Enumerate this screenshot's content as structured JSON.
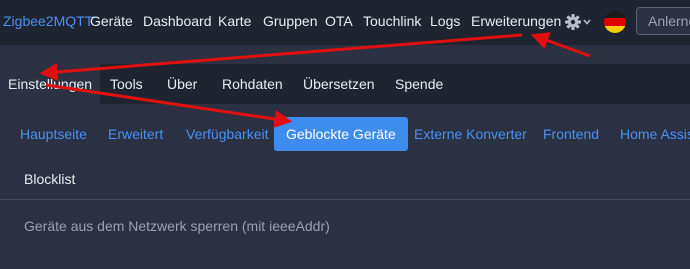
{
  "navbar": {
    "brand": "Zigbee2MQTT",
    "links": [
      "Geräte",
      "Dashboard",
      "Karte",
      "Gruppen",
      "OTA",
      "Touchlink",
      "Logs",
      "Erweiterungen"
    ],
    "settings_icon": "gear-icon",
    "flag_icon": "german-flag-icon",
    "search_placeholder": "Anlernen"
  },
  "tabs": [
    "Einstellungen",
    "Tools",
    "Über",
    "Rohdaten",
    "Übersetzen",
    "Spende"
  ],
  "subtabs": [
    "Hauptseite",
    "Erweitert",
    "Verfügbarkeit",
    "Geblockte Geräte",
    "Externe Konverter",
    "Frontend",
    "Home Assistant"
  ],
  "content": {
    "section_title": "Blocklist",
    "help_text": "Geräte aus dem Netzwerk sperren (mit ieeeAddr)"
  },
  "colors": {
    "navbar_bg": "#1f2431",
    "page_bg": "#2b3142",
    "accent": "#3f8cef",
    "link": "#4a90f5",
    "annotation_arrow": "#e01010"
  }
}
